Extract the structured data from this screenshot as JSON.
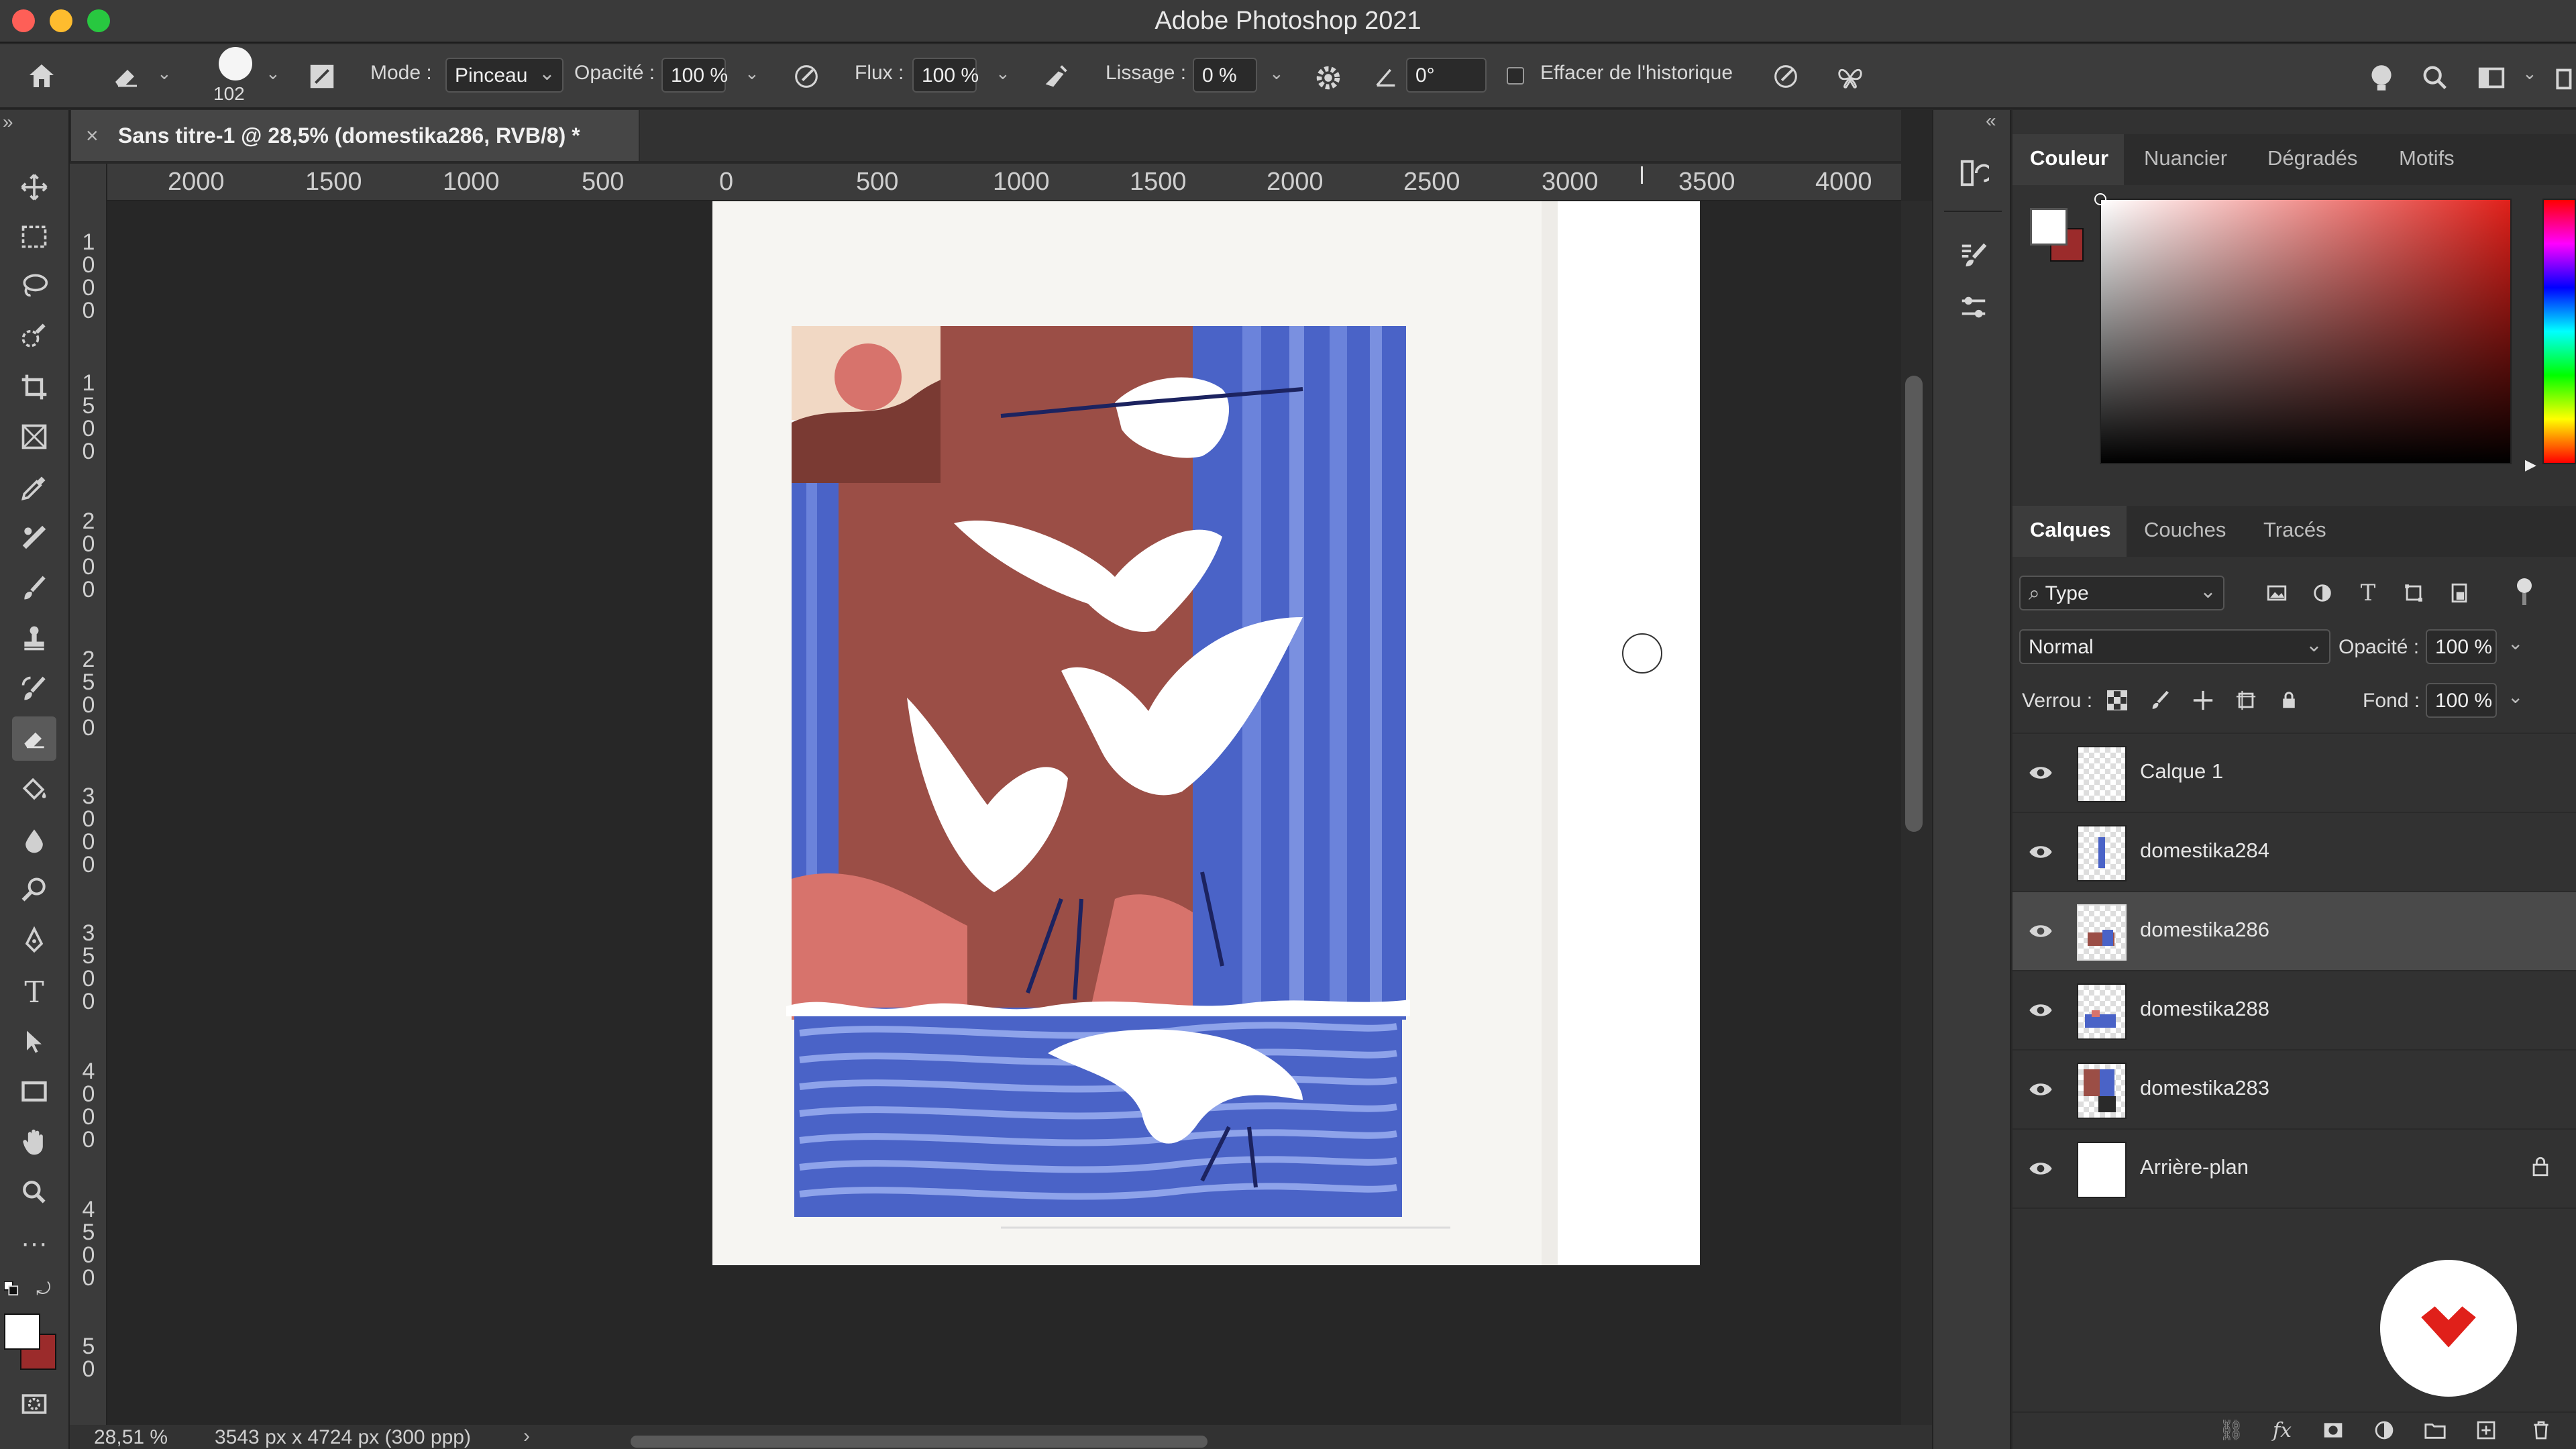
{
  "app": {
    "title": "Adobe Photoshop 2021"
  },
  "options_bar": {
    "brush_size": "102",
    "mode_label": "Mode :",
    "mode_value": "Pinceau",
    "opacity_label": "Opacité :",
    "opacity_value": "100 %",
    "flow_label": "Flux :",
    "flow_value": "100 %",
    "smoothing_label": "Lissage :",
    "smoothing_value": "0 %",
    "angle_value": "0°",
    "erase_history_label": "Effacer de l'historique"
  },
  "document": {
    "tab_title": "Sans titre-1 @ 28,5% (domestika286, RVB/8) *",
    "zoom": "28,51 %",
    "dimensions": "3543 px x 4724 px (300 ppp)"
  },
  "ruler_h": [
    "2000",
    "1500",
    "1000",
    "500",
    "0",
    "500",
    "1000",
    "1500",
    "2000",
    "2500",
    "3000",
    "3500",
    "4000"
  ],
  "ruler_v": [
    "1 0 0 0",
    "1 5 0 0",
    "2 0 0 0",
    "2 5 0 0",
    "3 0 0 0",
    "3 5 0 0",
    "4 0 0 0",
    "4 5 0 0",
    "5 0"
  ],
  "color_panel": {
    "tabs": [
      "Couleur",
      "Nuancier",
      "Dégradés",
      "Motifs"
    ],
    "active_tab": "Couleur",
    "foreground": "#ffffff",
    "background": "#9b2b2b"
  },
  "layers_panel": {
    "tabs": [
      "Calques",
      "Couches",
      "Tracés"
    ],
    "active_tab": "Calques",
    "filter_label": "Type",
    "blend_mode": "Normal",
    "opacity_label": "Opacité :",
    "opacity_value": "100 %",
    "lock_label": "Verrou :",
    "fill_label": "Fond :",
    "fill_value": "100 %",
    "layers": [
      {
        "name": "Calque 1",
        "selected": false
      },
      {
        "name": "domestika284",
        "selected": false
      },
      {
        "name": "domestika286",
        "selected": true
      },
      {
        "name": "domestika288",
        "selected": false
      },
      {
        "name": "domestika283",
        "selected": false
      },
      {
        "name": "Arrière-plan",
        "selected": false,
        "locked": true
      }
    ]
  },
  "colors": {
    "accent_red": "#e0201a",
    "artwork_blue": "#4a63c7",
    "artwork_brown": "#9b4e46",
    "artwork_salmon": "#d7736c"
  }
}
